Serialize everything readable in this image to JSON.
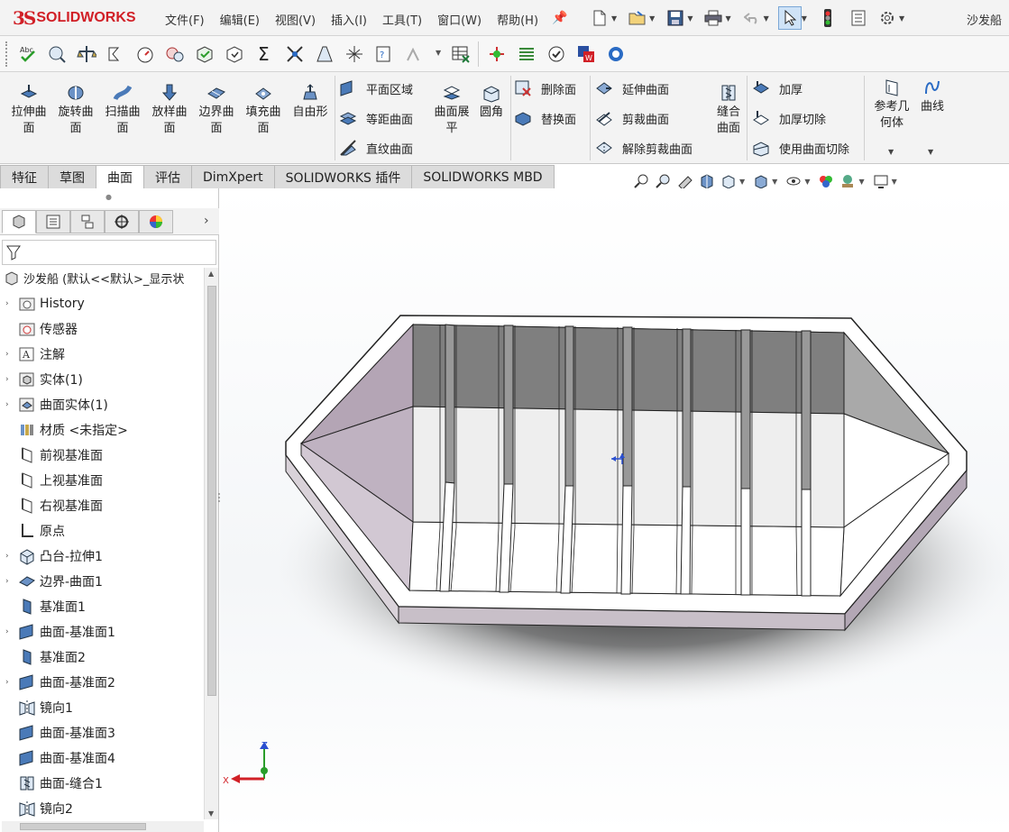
{
  "app": {
    "logo_ds": "3S",
    "logo_text": "SOLIDWORKS",
    "document_name": "沙发船"
  },
  "menu": [
    "文件(F)",
    "编辑(E)",
    "视图(V)",
    "插入(I)",
    "工具(T)",
    "窗口(W)",
    "帮助(H)"
  ],
  "ribbon": {
    "big_buttons": [
      {
        "label": "拉伸曲\n面",
        "icon": "extruded-surface-icon"
      },
      {
        "label": "旋转曲\n面",
        "icon": "revolved-surface-icon"
      },
      {
        "label": "扫描曲\n面",
        "icon": "swept-surface-icon"
      },
      {
        "label": "放样曲\n面",
        "icon": "lofted-surface-icon"
      },
      {
        "label": "边界曲\n面",
        "icon": "boundary-surface-icon"
      },
      {
        "label": "填充曲\n面",
        "icon": "filled-surface-icon"
      },
      {
        "label": "自由形",
        "icon": "freeform-icon"
      }
    ],
    "col1": [
      "平面区域",
      "等距曲面",
      "直纹曲面"
    ],
    "flatten": "曲面展\n平",
    "fillet": "圆角",
    "col2": [
      "删除面",
      "替换面"
    ],
    "col3": [
      "延伸曲面",
      "剪裁曲面",
      "解除剪裁曲面"
    ],
    "knit": "缝合\n曲面",
    "col4": [
      "加厚",
      "加厚切除",
      "使用曲面切除"
    ],
    "ref_geometry": "参考几\n何体",
    "curves": "曲线"
  },
  "tabs": [
    {
      "label": "特征",
      "active": false
    },
    {
      "label": "草图",
      "active": false
    },
    {
      "label": "曲面",
      "active": true
    },
    {
      "label": "评估",
      "active": false
    },
    {
      "label": "DimXpert",
      "active": false
    },
    {
      "label": "SOLIDWORKS 插件",
      "active": false
    },
    {
      "label": "SOLIDWORKS MBD",
      "active": false
    }
  ],
  "tree": {
    "root": "沙发船  (默认<<默认>_显示状",
    "items": [
      {
        "label": "History",
        "expandable": true,
        "icon": "history-folder-icon"
      },
      {
        "label": "传感器",
        "expandable": false,
        "icon": "sensor-icon"
      },
      {
        "label": "注解",
        "expandable": true,
        "icon": "annotation-icon"
      },
      {
        "label": "实体(1)",
        "expandable": true,
        "icon": "solid-bodies-icon"
      },
      {
        "label": "曲面实体(1)",
        "expandable": true,
        "icon": "surface-bodies-icon"
      },
      {
        "label": "材质 <未指定>",
        "expandable": false,
        "icon": "material-icon"
      },
      {
        "label": "前视基准面",
        "expandable": false,
        "icon": "plane-icon"
      },
      {
        "label": "上视基准面",
        "expandable": false,
        "icon": "plane-icon"
      },
      {
        "label": "右视基准面",
        "expandable": false,
        "icon": "plane-icon"
      },
      {
        "label": "原点",
        "expandable": false,
        "icon": "origin-icon"
      },
      {
        "label": "凸台-拉伸1",
        "expandable": true,
        "icon": "boss-extrude-icon"
      },
      {
        "label": "边界-曲面1",
        "expandable": true,
        "icon": "boundary-surface-icon"
      },
      {
        "label": "基准面1",
        "expandable": false,
        "icon": "ref-plane-icon"
      },
      {
        "label": "曲面-基准面1",
        "expandable": true,
        "icon": "planar-surface-icon"
      },
      {
        "label": "基准面2",
        "expandable": false,
        "icon": "ref-plane-icon"
      },
      {
        "label": "曲面-基准面2",
        "expandable": true,
        "icon": "planar-surface-icon"
      },
      {
        "label": "镜向1",
        "expandable": false,
        "icon": "mirror-icon"
      },
      {
        "label": "曲面-基准面3",
        "expandable": false,
        "icon": "planar-surface-icon"
      },
      {
        "label": "曲面-基准面4",
        "expandable": false,
        "icon": "planar-surface-icon"
      },
      {
        "label": "曲面-缝合1",
        "expandable": false,
        "icon": "knit-surface-icon"
      },
      {
        "label": "镜向2",
        "expandable": false,
        "icon": "mirror-icon"
      }
    ]
  },
  "triad": {
    "x": "X",
    "z": "Z"
  },
  "colors": {
    "brand": "#d12027",
    "accent": "#2a6bc4"
  }
}
